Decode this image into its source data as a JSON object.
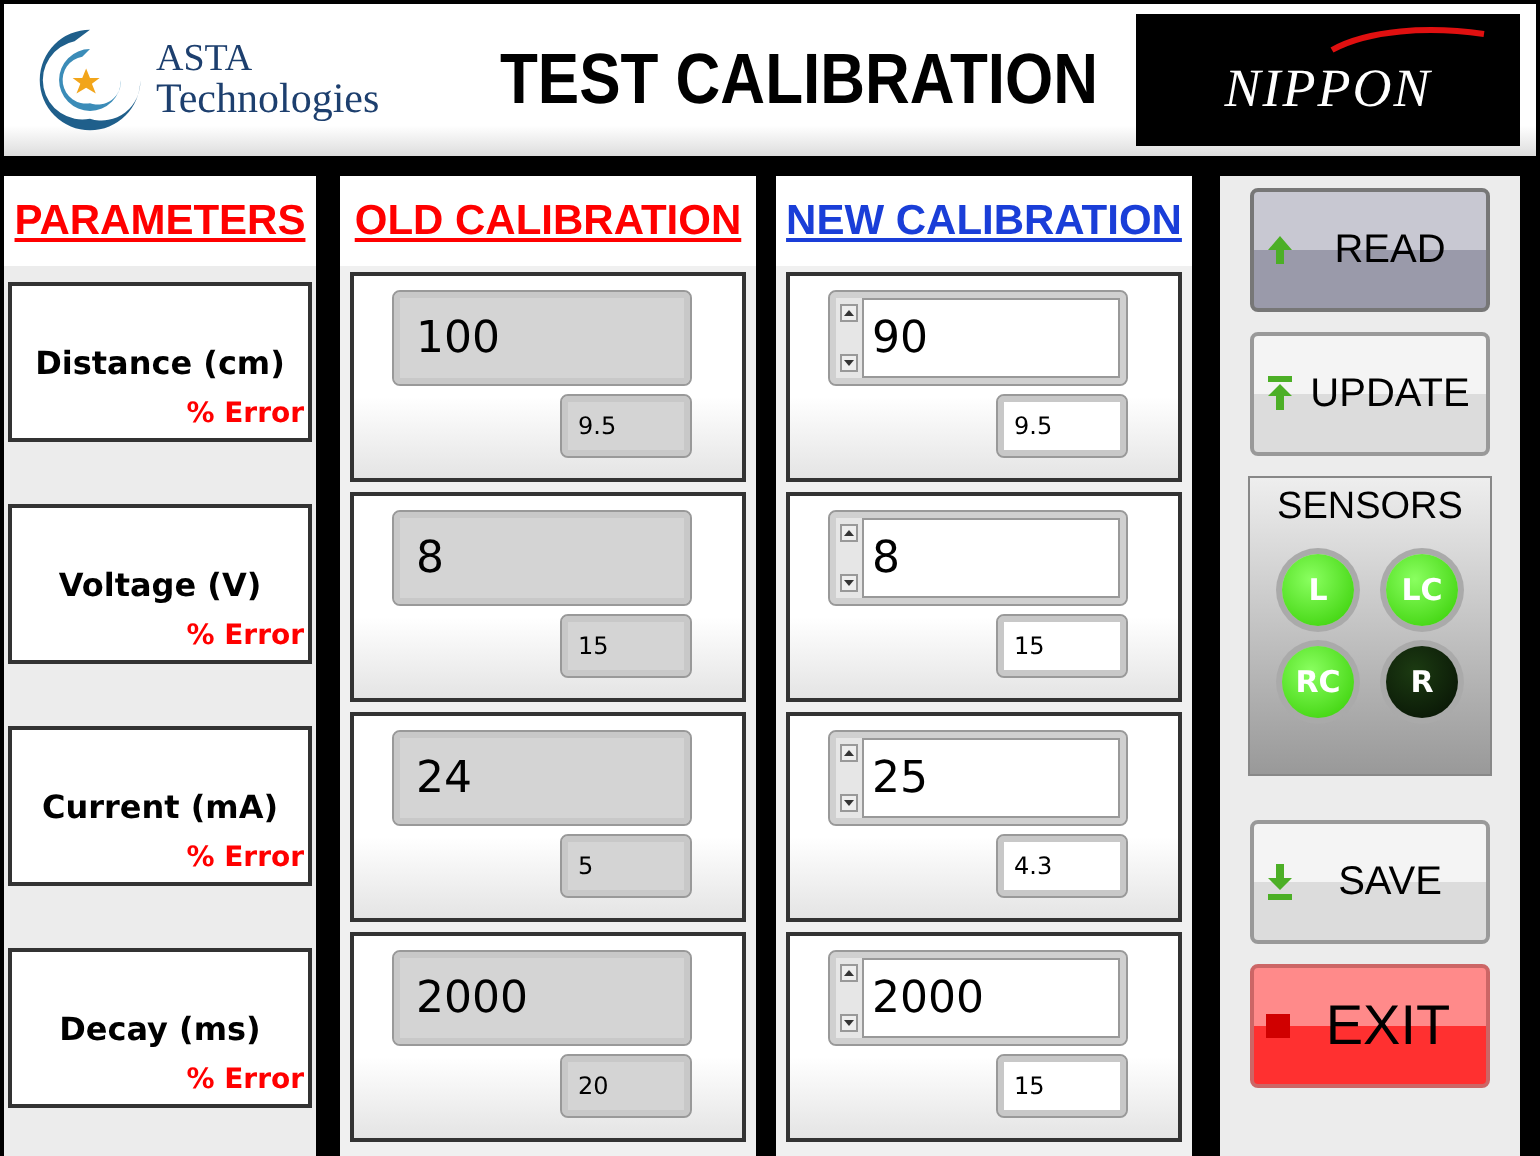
{
  "header": {
    "logo_line1": "ASTA",
    "logo_line2": "Technologies",
    "title": "TEST CALIBRATION",
    "brand": "NIPPON"
  },
  "parameters": {
    "heading": "PARAMETERS",
    "rows": [
      {
        "name": "Distance (cm)",
        "error_label": "% Error"
      },
      {
        "name": "Voltage (V)",
        "error_label": "% Error"
      },
      {
        "name": "Current (mA)",
        "error_label": "% Error"
      },
      {
        "name": "Decay (ms)",
        "error_label": "% Error"
      }
    ]
  },
  "old_calibration": {
    "heading": "OLD CALIBRATION",
    "rows": [
      {
        "value": "100",
        "error": "9.5"
      },
      {
        "value": "8",
        "error": "15"
      },
      {
        "value": "24",
        "error": "5"
      },
      {
        "value": "2000",
        "error": "20"
      }
    ]
  },
  "new_calibration": {
    "heading": "NEW CALIBRATION",
    "rows": [
      {
        "value": "90",
        "error": "9.5"
      },
      {
        "value": "8",
        "error": "15"
      },
      {
        "value": "25",
        "error": "4.3"
      },
      {
        "value": "2000",
        "error": "15"
      }
    ]
  },
  "top_buttons": [
    {
      "label": "READ",
      "kind": "read",
      "pressed": true
    },
    {
      "label": "UPDATE",
      "kind": "update",
      "pressed": false
    }
  ],
  "sensors": {
    "heading": "SENSORS",
    "lamps": [
      {
        "label": "L",
        "on": true
      },
      {
        "label": "LC",
        "on": true
      },
      {
        "label": "RC",
        "on": true
      },
      {
        "label": "R",
        "on": false
      }
    ]
  },
  "bottom_buttons": [
    {
      "label": "SAVE",
      "kind": "save",
      "pressed": false
    },
    {
      "label": "EXIT",
      "kind": "exit",
      "pressed": false
    }
  ]
}
